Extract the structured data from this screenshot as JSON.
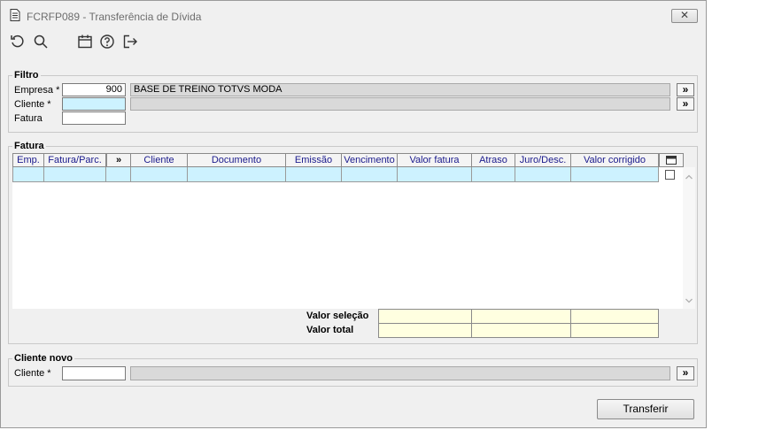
{
  "window": {
    "title": "FCRFP089 - Transferência de Dívida",
    "close_label": "✕"
  },
  "toolbar": {
    "icons": [
      "refresh-icon",
      "search-icon",
      "calendar-icon",
      "help-icon",
      "exit-icon"
    ]
  },
  "filtro": {
    "title": "Filtro",
    "empresa_label": "Empresa *",
    "empresa_value": "900",
    "empresa_desc": "BASE DE TREINO TOTVS MODA",
    "cliente_label": "Cliente *",
    "cliente_value": "",
    "cliente_desc": "",
    "fatura_label": "Fatura",
    "fatura_value": "",
    "lookup_label": "»"
  },
  "fatura": {
    "title": "Fatura",
    "columns": [
      "Emp.",
      "Fatura/Parc.",
      "»",
      "Cliente",
      "Documento",
      "Emissão",
      "Vencimento",
      "Valor fatura",
      "Atraso",
      "Juro/Desc.",
      "Valor corrigido"
    ],
    "valor_selecao_label": "Valor seleção",
    "valor_total_label": "Valor total"
  },
  "cliente_novo": {
    "title": "Cliente novo",
    "cliente_label": "Cliente *",
    "cliente_value": "",
    "cliente_desc": "",
    "lookup_label": "»"
  },
  "actions": {
    "transferir_label": "Transferir"
  }
}
